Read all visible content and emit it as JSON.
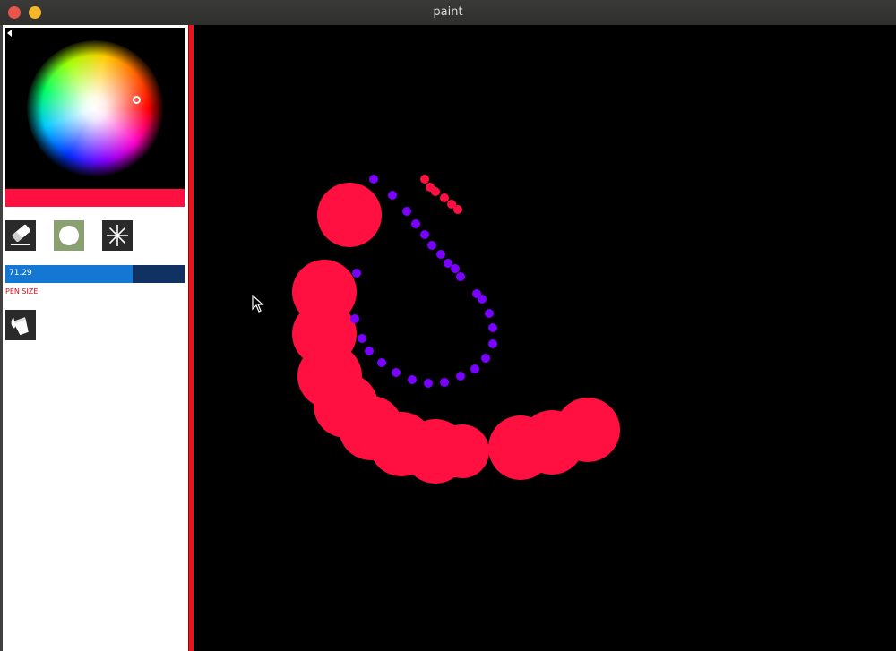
{
  "window": {
    "title": "paint"
  },
  "colors": {
    "brush": "#ff1040",
    "stroke_secondary": "#7a00ff",
    "accent_edge": "#e8141e",
    "size_fill": "#1477d3",
    "size_track": "#0f3262",
    "label_red": "#d2101a"
  },
  "toolbar": {
    "tools": [
      {
        "name": "eraser",
        "icon": "eraser-icon"
      },
      {
        "name": "brush",
        "icon": "round-brush-icon"
      },
      {
        "name": "spray",
        "icon": "spray-icon"
      }
    ],
    "fill_icon": "paint-bucket-icon"
  },
  "pen_size": {
    "value": "71.29",
    "fraction": 0.71,
    "label": "PEN SIZE"
  }
}
